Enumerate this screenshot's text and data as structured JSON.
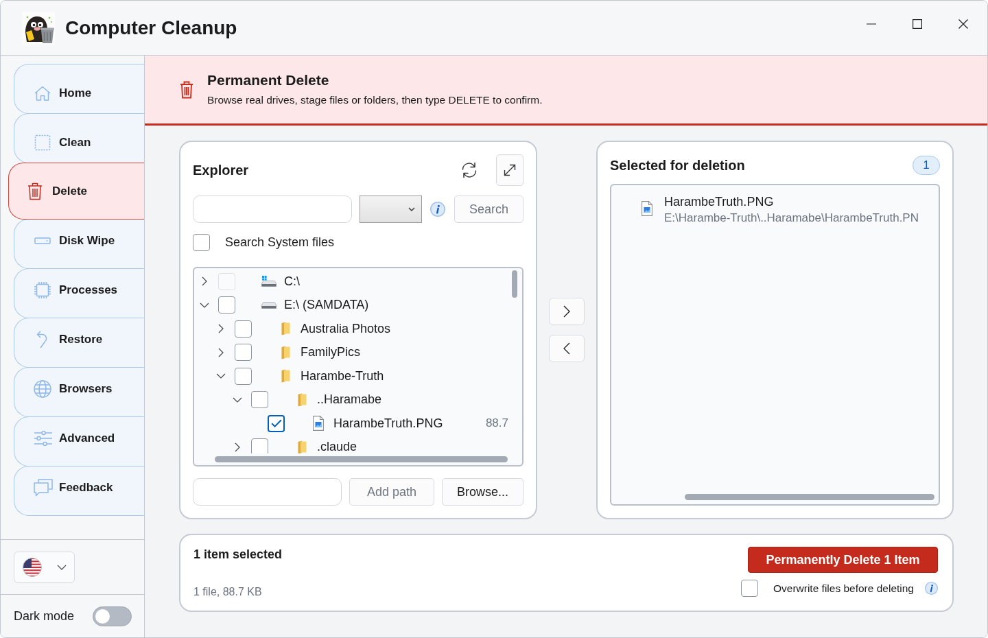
{
  "window": {
    "title": "Computer Cleanup"
  },
  "sidebar": {
    "items": [
      {
        "label": "Home",
        "selected": false
      },
      {
        "label": "Clean",
        "selected": false
      },
      {
        "label": "Delete",
        "selected": true
      },
      {
        "label": "Disk Wipe",
        "selected": false
      },
      {
        "label": "Processes",
        "selected": false
      },
      {
        "label": "Restore",
        "selected": false
      },
      {
        "label": "Browsers",
        "selected": false
      },
      {
        "label": "Advanced",
        "selected": false
      },
      {
        "label": "Feedback",
        "selected": false
      }
    ],
    "dark_mode": {
      "label": "Dark mode",
      "on": false
    }
  },
  "header": {
    "title": "Permanent Delete",
    "subtitle": "Browse real drives, stage files or folders, then type DELETE to confirm."
  },
  "explorer": {
    "title": "Explorer",
    "search_button": {
      "label": "Search",
      "disabled": true
    },
    "search_system_files": {
      "label": "Search System files",
      "checked": false
    },
    "tree": [
      {
        "label": "C:\\",
        "kind": "system_drive",
        "expanded": false,
        "checked": false,
        "disabled": true
      },
      {
        "label": "E:\\ (SAMDATA)",
        "kind": "drive",
        "expanded": true,
        "checked": false,
        "disabled": false,
        "children": [
          {
            "label": "Australia Photos",
            "kind": "folder",
            "expanded": false,
            "checked": false,
            "disabled": false
          },
          {
            "label": "FamilyPics",
            "kind": "folder",
            "expanded": false,
            "checked": false,
            "disabled": false
          },
          {
            "label": "Harambe-Truth",
            "kind": "folder",
            "expanded": true,
            "checked": false,
            "disabled": false,
            "children": [
              {
                "label": "..Haramabe",
                "kind": "folder",
                "expanded": true,
                "checked": false,
                "disabled": false,
                "children": [
                  {
                    "label": "HarambeTruth.PNG",
                    "kind": "file",
                    "checked": true,
                    "disabled": false,
                    "size": "88.7"
                  }
                ]
              },
              {
                "label": ".claude",
                "kind": "folder",
                "expanded": false,
                "checked": false,
                "disabled": false
              }
            ]
          }
        ]
      }
    ],
    "add_path_button": {
      "label": "Add path",
      "disabled": true
    },
    "browse_button": {
      "label": "Browse...",
      "disabled": false
    }
  },
  "selection": {
    "title": "Selected for deletion",
    "count": "1",
    "items": [
      {
        "name": "HarambeTruth.PNG",
        "path": "E:\\Harambe-Truth\\..Haramabe\\HarambeTruth.PN"
      }
    ]
  },
  "summary": {
    "title": "1 item selected",
    "detail": "1 file, 88.7 KB",
    "delete_button": "Permanently Delete 1 Item",
    "overwrite": {
      "label": "Overwrite files before deleting",
      "checked": false
    }
  }
}
